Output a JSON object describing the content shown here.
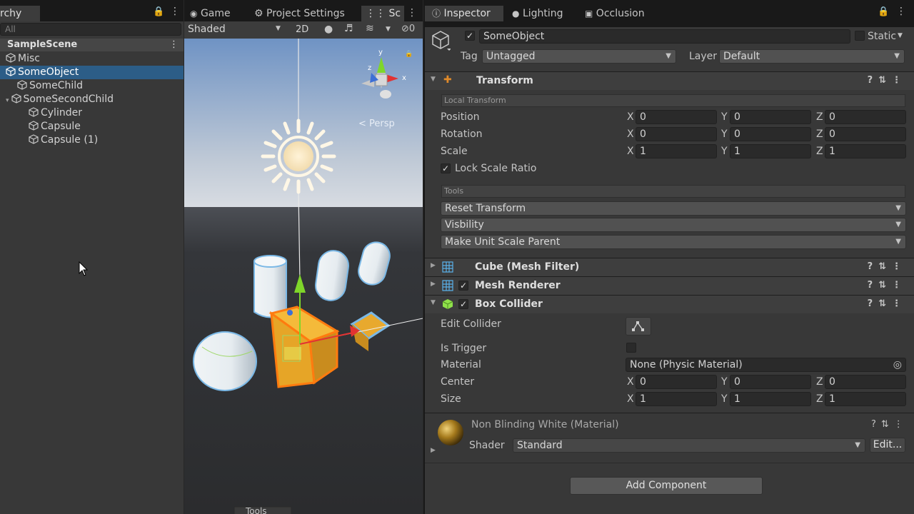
{
  "hierarchy": {
    "tab_label": "rchy",
    "search_placeholder": "All",
    "scene": "SampleScene",
    "items": [
      {
        "label": "Misc"
      },
      {
        "label": "SomeObject"
      },
      {
        "label": "SomeChild"
      },
      {
        "label": "SomeSecondChild"
      },
      {
        "label": "Cylinder"
      },
      {
        "label": "Capsule"
      },
      {
        "label": "Capsule (1)"
      }
    ]
  },
  "scene_view": {
    "tabs": [
      "Game",
      "Project Settings",
      "Sc"
    ],
    "shading_mode": "Shaded",
    "mode_2d": "2D",
    "gizmo_count": "0",
    "projection_label": "< Persp",
    "tools_overlay": "Tools"
  },
  "inspector": {
    "tabs": [
      "Inspector",
      "Lighting",
      "Occlusion"
    ],
    "object_name": "SomeObject",
    "static_label": "Static",
    "tag_label": "Tag",
    "tag_value": "Untagged",
    "layer_label": "Layer",
    "layer_value": "Default",
    "transform": {
      "title": "Transform",
      "local_header": "Local Transform",
      "position_label": "Position",
      "rotation_label": "Rotation",
      "scale_label": "Scale",
      "position": {
        "x": "0",
        "y": "0",
        "z": "0"
      },
      "rotation": {
        "x": "0",
        "y": "0",
        "z": "0"
      },
      "scale": {
        "x": "1",
        "y": "1",
        "z": "1"
      },
      "lock_scale_label": "Lock Scale Ratio",
      "tools_header": "Tools",
      "reset_transform": "Reset Transform",
      "visibility": "Visbility",
      "make_unit_scale": "Make Unit Scale Parent"
    },
    "mesh_filter_title": "Cube (Mesh Filter)",
    "mesh_renderer_title": "Mesh Renderer",
    "box_collider": {
      "title": "Box Collider",
      "edit_collider_label": "Edit Collider",
      "is_trigger_label": "Is Trigger",
      "material_label": "Material",
      "material_value": "None (Physic Material)",
      "center_label": "Center",
      "size_label": "Size",
      "center": {
        "x": "0",
        "y": "0",
        "z": "0"
      },
      "size": {
        "x": "1",
        "y": "1",
        "z": "1"
      }
    },
    "material": {
      "title": "Non Blinding White (Material)",
      "shader_label": "Shader",
      "shader_value": "Standard",
      "edit_button": "Edit..."
    },
    "add_component": "Add Component",
    "axis_x": "X",
    "axis_y": "Y",
    "axis_z": "Z"
  },
  "colors": {
    "selection": "#2c5d87",
    "panel": "#383838",
    "tabbar": "#191919",
    "highlight_orange": "#ff7b0f"
  }
}
